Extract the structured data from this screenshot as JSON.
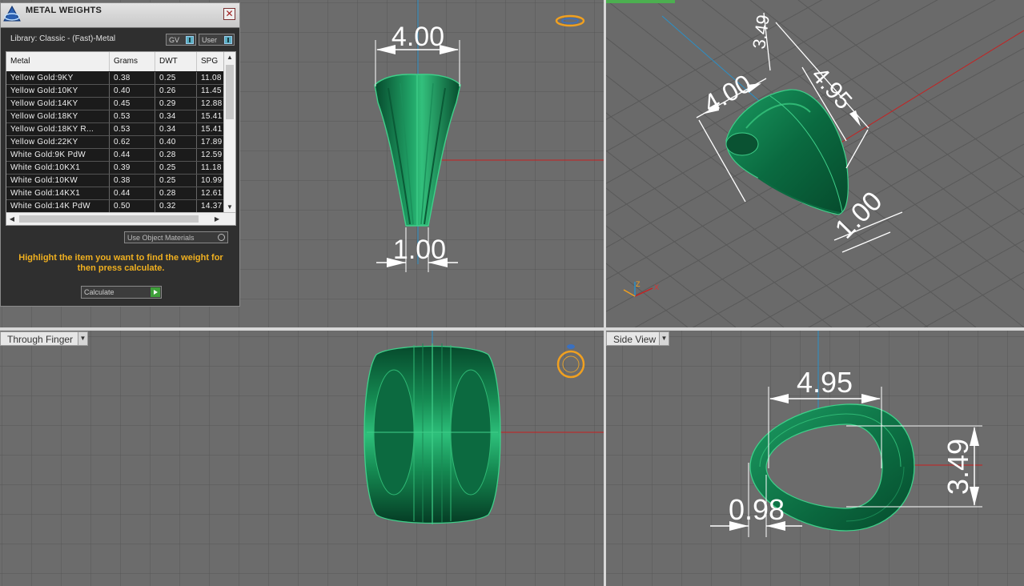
{
  "panel": {
    "title": "METAL WEIGHTS",
    "library_label": "Library: Classic - (Fast)-Metal",
    "toggles": [
      "GV",
      "User"
    ],
    "columns": [
      "Metal",
      "Grams",
      "DWT",
      "SPG"
    ],
    "rows": [
      [
        "Yellow Gold:9KY",
        "0.38",
        "0.25",
        "11.08"
      ],
      [
        "Yellow Gold:10KY",
        "0.40",
        "0.26",
        "11.45"
      ],
      [
        "Yellow Gold:14KY",
        "0.45",
        "0.29",
        "12.88"
      ],
      [
        "Yellow Gold:18KY",
        "0.53",
        "0.34",
        "15.41"
      ],
      [
        "Yellow Gold:18KY R...",
        "0.53",
        "0.34",
        "15.41"
      ],
      [
        "Yellow Gold:22KY",
        "0.62",
        "0.40",
        "17.89"
      ],
      [
        "White Gold:9K PdW",
        "0.44",
        "0.28",
        "12.59"
      ],
      [
        "White Gold:10KX1",
        "0.39",
        "0.25",
        "11.18"
      ],
      [
        "White Gold:10KW",
        "0.38",
        "0.25",
        "10.99"
      ],
      [
        "White Gold:14KX1",
        "0.44",
        "0.28",
        "12.61"
      ],
      [
        "White Gold:14K PdW",
        "0.50",
        "0.32",
        "14.37"
      ]
    ],
    "use_object_materials": "Use Object Materials",
    "instruction": "Highlight the item you want to find the weight for then press calculate.",
    "calculate_label": "Calculate"
  },
  "viewports": {
    "top_left": {
      "dims": [
        "4.00",
        "1.00"
      ]
    },
    "top_right": {
      "dims": [
        "3.49",
        "4.00",
        "4.95",
        "1.00"
      ],
      "axes": [
        "Z",
        "X"
      ]
    },
    "bottom_left": {
      "label": "Through Finger"
    },
    "bottom_right": {
      "label": "Side View",
      "dims": [
        "4.95",
        "3.49",
        "0.98"
      ]
    }
  },
  "colors": {
    "ring": "#0f7a4c",
    "ring_light": "#3fd08a",
    "instruction": "#f0b020",
    "axis_red": "#c82020",
    "axis_blue": "#2a90c8"
  }
}
